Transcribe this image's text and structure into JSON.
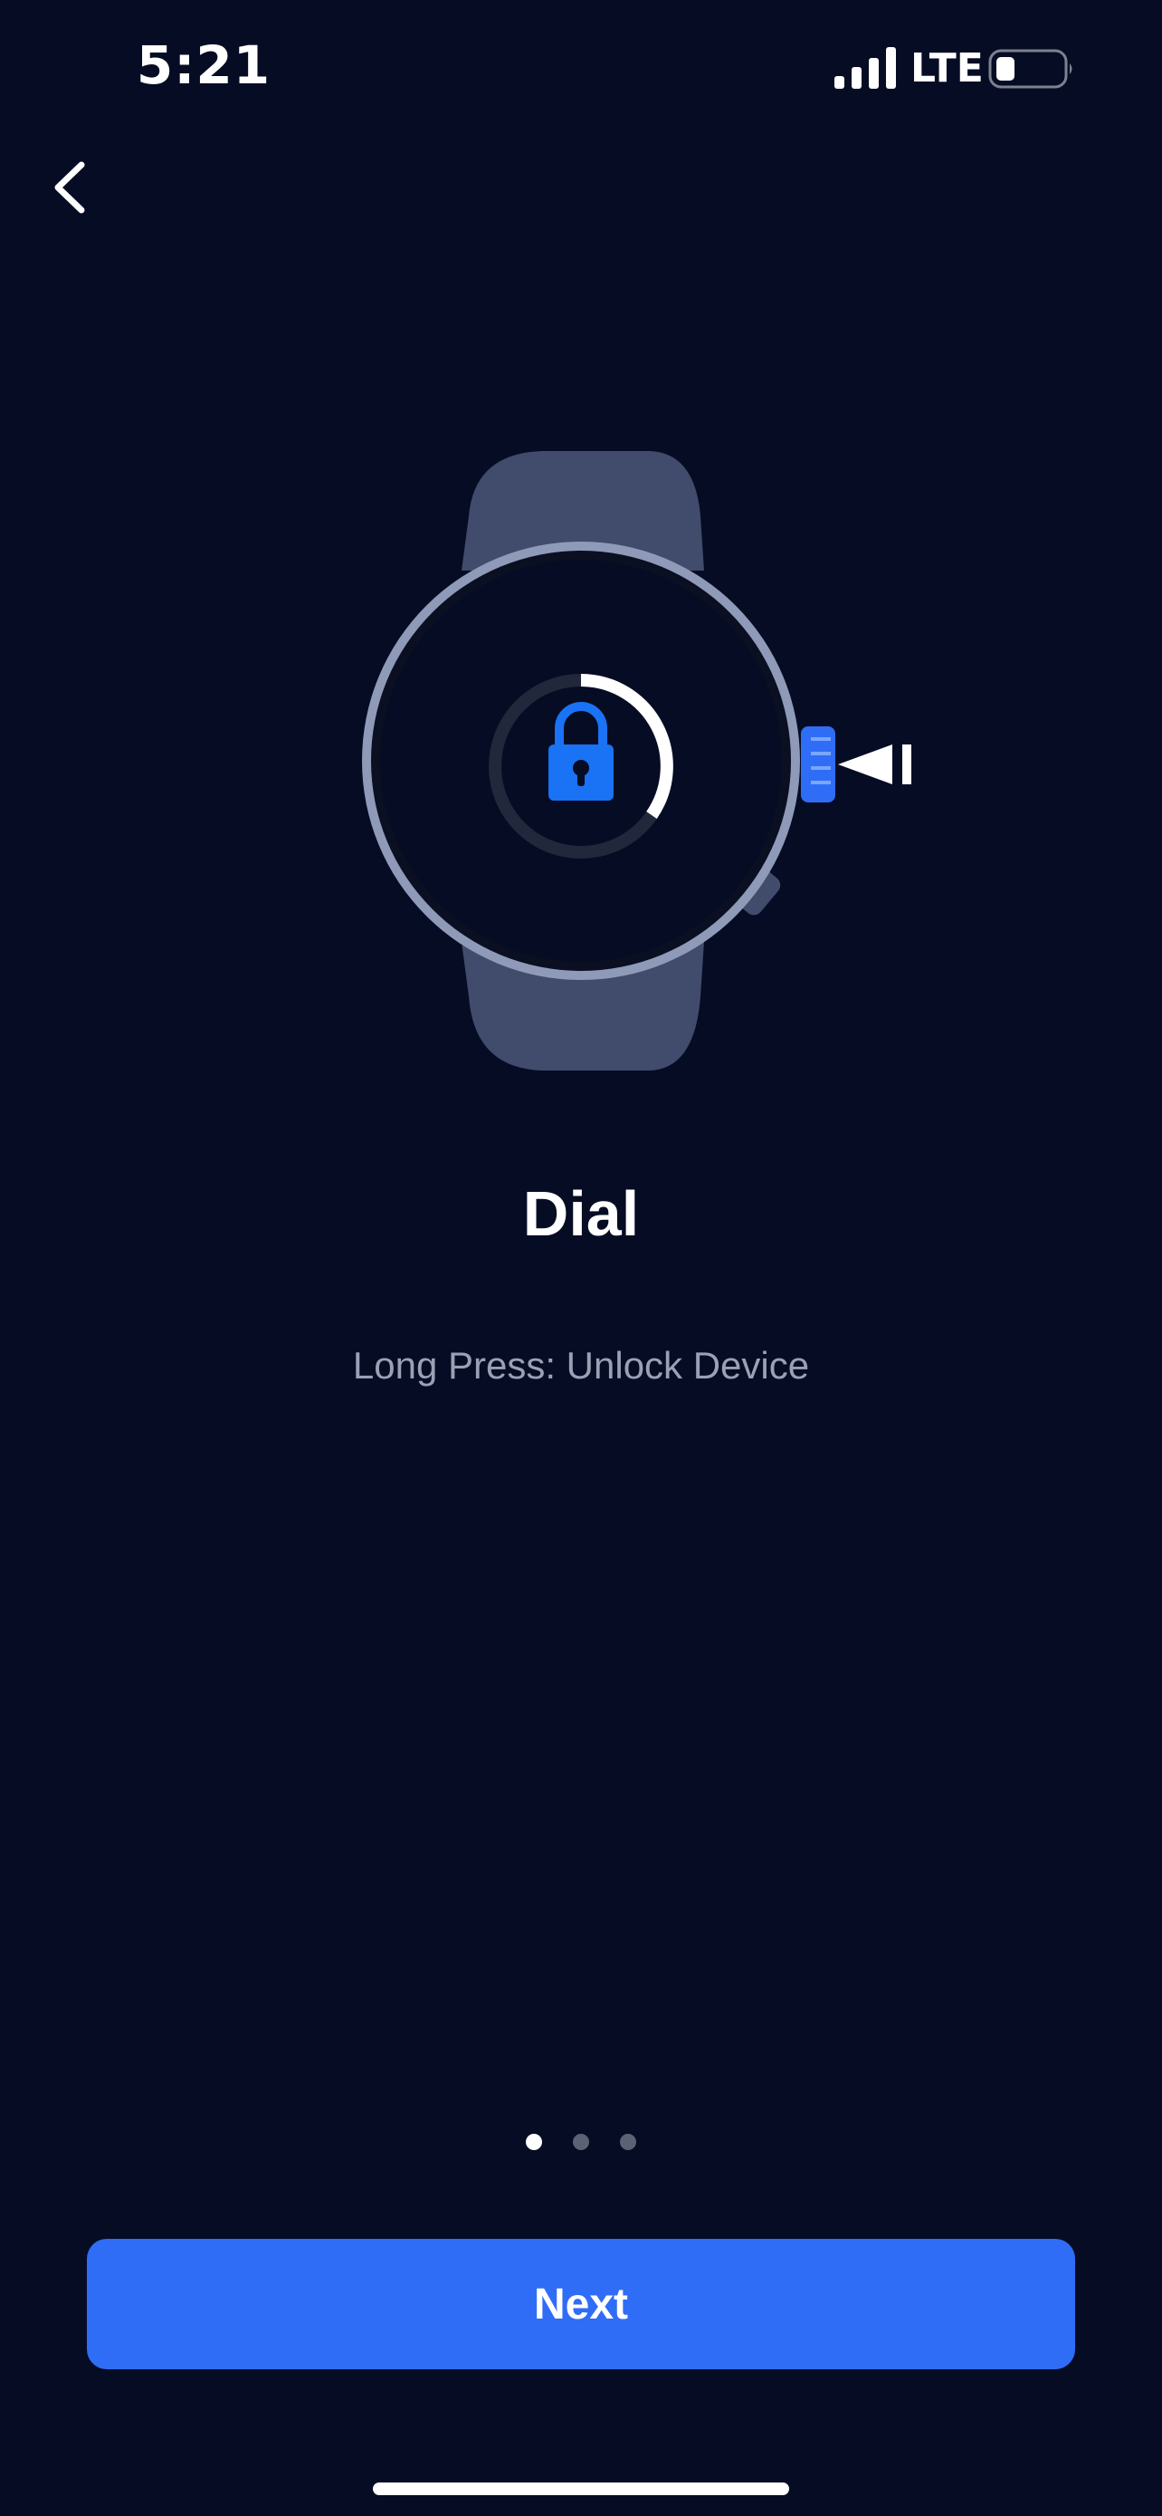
{
  "status_bar": {
    "time": "5:21",
    "network": "LTE"
  },
  "nav": {
    "back_icon": "chevron-left-icon"
  },
  "illustration": {
    "watch_icon": "smartwatch-icon",
    "lock_icon": "lock-icon",
    "pointer_icon": "arrow-left-icon"
  },
  "content": {
    "title": "Dial",
    "subtitle": "Long Press: Unlock Device"
  },
  "pagination": {
    "total": 3,
    "current": 1
  },
  "actions": {
    "next_label": "Next"
  },
  "colors": {
    "background": "#060c24",
    "accent": "#2f6df6",
    "watch_band": "#414c6c",
    "watch_bezel": "#8f9ab8"
  }
}
